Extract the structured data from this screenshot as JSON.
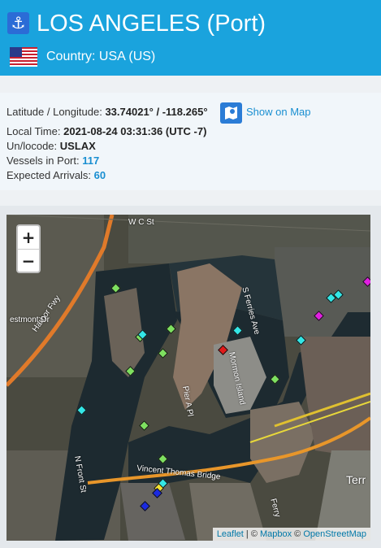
{
  "header": {
    "title": "LOS ANGELES (Port)",
    "country": "Country: USA (US)",
    "anchor_icon": "anchor-icon",
    "flag_icon": "usa-flag-icon",
    "bg_color": "#1aa3dd"
  },
  "info": {
    "latlon_label": "Latitude / Longitude:",
    "latlon_value": "33.74021° / -118.265°",
    "show_map": "Show on Map",
    "local_time_label": "Local Time:",
    "local_time_value": "2021-08-24 03:31:36 (UTC -7)",
    "unlocode_label": "Un/locode:",
    "unlocode_value": "USLAX",
    "vessels_label": "Vessels in Port:",
    "vessels_value": "117",
    "arrivals_label": "Expected Arrivals:",
    "arrivals_value": "60"
  },
  "map": {
    "zoom_in": "+",
    "zoom_out": "−",
    "labels": {
      "w_st": "W C St",
      "harbor_fwy": "Harbor Fwy",
      "estmont": "estmont Dr",
      "s_ferries": "S Ferries Ave",
      "pier_a": "Pier A Pl",
      "mormon": "Mormon Island",
      "n_front": "N Front St",
      "vincent": "Vincent Thomas Bridge",
      "terr": "Terr",
      "ferry": "Ferry"
    },
    "attribution": {
      "leaflet": "Leaflet",
      "sep1": " | © ",
      "mapbox": "Mapbox",
      "sep2": " © ",
      "osm": "OpenStreetMap"
    },
    "marker_colors": {
      "green": "#7ee060",
      "cyan": "#33e6e6",
      "magenta": "#e020e0",
      "red": "#e21a1a",
      "yellow": "#f2e233",
      "blue": "#1a2ae0"
    }
  }
}
